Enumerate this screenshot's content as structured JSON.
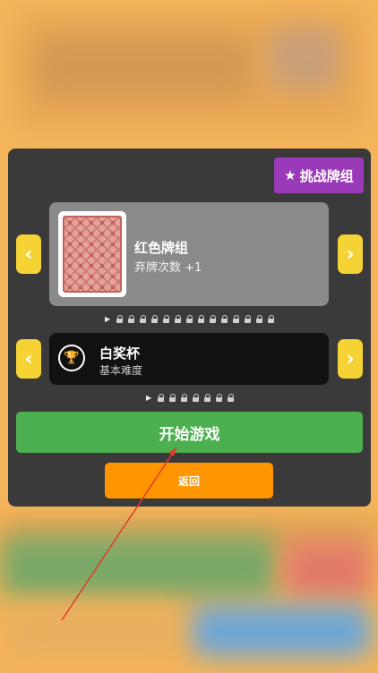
{
  "challenge": {
    "star_icon": "★",
    "label": "挑战牌组"
  },
  "deck": {
    "name": "红色牌组",
    "effect": "弃牌次数 +1",
    "locked_count": 14
  },
  "stake": {
    "name": "白奖杯",
    "difficulty": "基本难度",
    "locked_count": 7
  },
  "buttons": {
    "prev_glyph": "‹",
    "next_glyph": "›",
    "start": "开始游戏",
    "back": "返回"
  },
  "colors": {
    "challenge": "#9b3ab8",
    "arrow": "#f5d335",
    "start": "#4caf50",
    "back": "#ff9500",
    "annotation_line": "#e23a2a"
  }
}
